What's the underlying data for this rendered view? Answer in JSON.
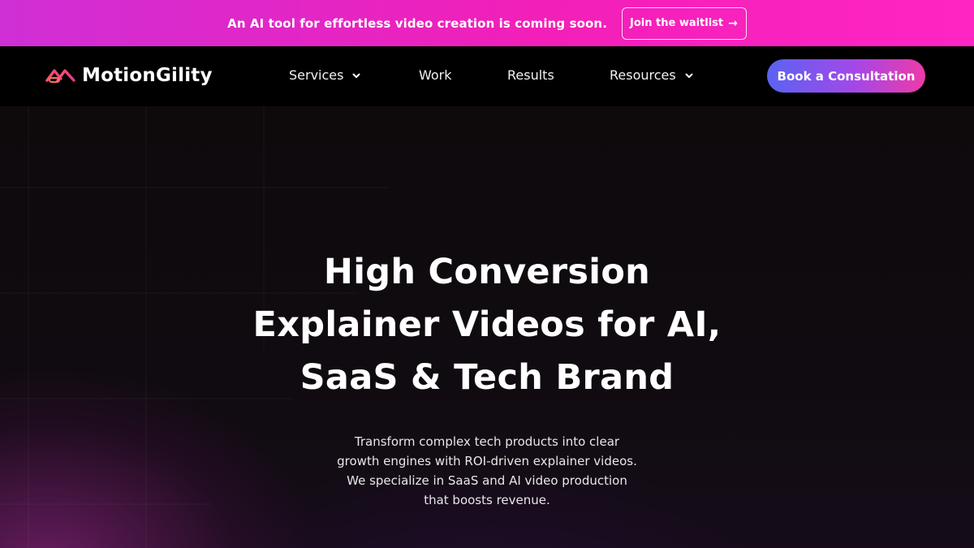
{
  "announcement": {
    "text": "An AI tool for effortless video creation is coming soon.",
    "button_label": "Join the waitlist",
    "button_icon": "arrow-right-icon"
  },
  "nav": {
    "logo_text": "MotionGility",
    "items": [
      {
        "label": "Services",
        "has_dropdown": true
      },
      {
        "label": "Work",
        "has_dropdown": false
      },
      {
        "label": "Results",
        "has_dropdown": false
      },
      {
        "label": "Resources",
        "has_dropdown": true
      }
    ],
    "cta_label": "Book a Consultation"
  },
  "hero": {
    "title_lines": [
      "High Conversion",
      "Explainer Videos for AI,",
      "SaaS & Tech Brand"
    ],
    "subtitle_lines": [
      "Transform complex tech products into clear",
      "growth engines with ROI-driven explainer videos.",
      "We specialize in SaaS and AI video production",
      "that boosts revenue."
    ]
  },
  "colors": {
    "announcement_bg": "#f21fb8",
    "nav_bg": "#000000",
    "cta_gradient_start": "#5a63f2",
    "cta_gradient_end": "#ee3aa8",
    "hero_glow": "#a82896"
  }
}
